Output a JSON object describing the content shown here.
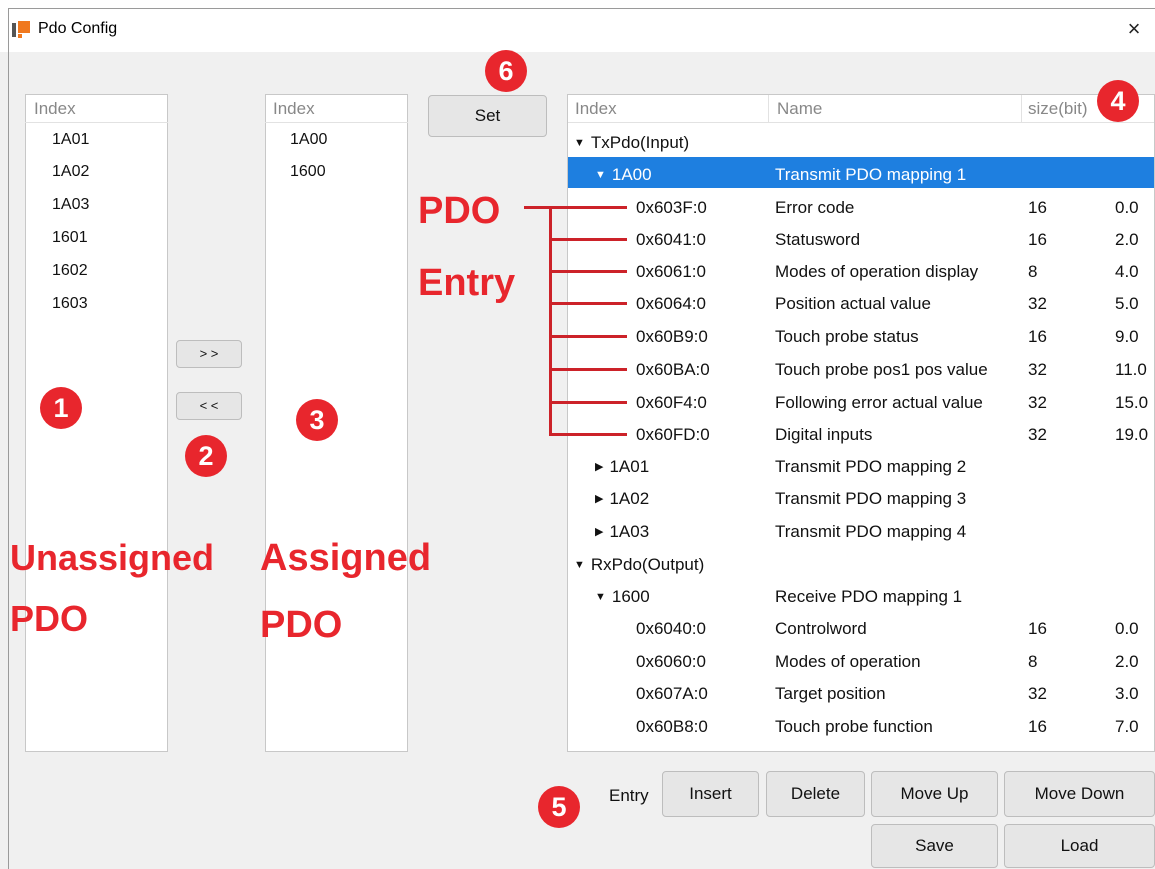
{
  "window": {
    "title": "Pdo Config",
    "close_glyph": "×"
  },
  "left_list": {
    "header": "Index",
    "items": [
      "1A01",
      "1A02",
      "1A03",
      "1601",
      "1602",
      "1603"
    ]
  },
  "middle_list": {
    "header": "Index",
    "items": [
      "1A00",
      "1600"
    ]
  },
  "transfer": {
    "add_label": "> >",
    "remove_label": "< <"
  },
  "set_button": {
    "label": "Set"
  },
  "tree": {
    "columns": [
      "Index",
      "Name",
      "size(bit)"
    ],
    "rows": [
      {
        "index": "TxPdo(Input)",
        "name": "",
        "size": "",
        "offset": "",
        "toggle": "▼"
      },
      {
        "index": "1A00",
        "name": "Transmit PDO mapping 1",
        "size": "",
        "offset": "",
        "toggle": "▼"
      },
      {
        "index": "0x603F:0",
        "name": "Error code",
        "size": "16",
        "offset": "0.0",
        "toggle": ""
      },
      {
        "index": "0x6041:0",
        "name": "Statusword",
        "size": "16",
        "offset": "2.0",
        "toggle": ""
      },
      {
        "index": "0x6061:0",
        "name": "Modes of operation display",
        "size": "8",
        "offset": "4.0",
        "toggle": ""
      },
      {
        "index": "0x6064:0",
        "name": "Position actual value",
        "size": "32",
        "offset": "5.0",
        "toggle": ""
      },
      {
        "index": "0x60B9:0",
        "name": "Touch probe status",
        "size": "16",
        "offset": "9.0",
        "toggle": ""
      },
      {
        "index": "0x60BA:0",
        "name": "Touch probe pos1 pos value",
        "size": "32",
        "offset": "11.0",
        "toggle": ""
      },
      {
        "index": "0x60F4:0",
        "name": "Following error actual value",
        "size": "32",
        "offset": "15.0",
        "toggle": ""
      },
      {
        "index": "0x60FD:0",
        "name": "Digital inputs",
        "size": "32",
        "offset": "19.0",
        "toggle": ""
      },
      {
        "index": "1A01",
        "name": "Transmit PDO mapping 2",
        "size": "",
        "offset": "",
        "toggle": "▶"
      },
      {
        "index": "1A02",
        "name": "Transmit PDO mapping 3",
        "size": "",
        "offset": "",
        "toggle": "▶"
      },
      {
        "index": "1A03",
        "name": "Transmit PDO mapping 4",
        "size": "",
        "offset": "",
        "toggle": "▶"
      },
      {
        "index": "RxPdo(Output)",
        "name": "",
        "size": "",
        "offset": "",
        "toggle": "▼"
      },
      {
        "index": "1600",
        "name": "Receive PDO mapping 1",
        "size": "",
        "offset": "",
        "toggle": "▼"
      },
      {
        "index": "0x6040:0",
        "name": "Controlword",
        "size": "16",
        "offset": "0.0",
        "toggle": ""
      },
      {
        "index": "0x6060:0",
        "name": "Modes of operation",
        "size": "8",
        "offset": "2.0",
        "toggle": ""
      },
      {
        "index": "0x607A:0",
        "name": "Target position",
        "size": "32",
        "offset": "3.0",
        "toggle": ""
      },
      {
        "index": "0x60B8:0",
        "name": "Touch probe function",
        "size": "16",
        "offset": "7.0",
        "toggle": ""
      }
    ]
  },
  "entry_bar": {
    "label": "Entry",
    "insert": "Insert",
    "delete": "Delete",
    "move_up": "Move Up",
    "move_down": "Move Down",
    "save": "Save",
    "load": "Load"
  },
  "annotations": {
    "circles": [
      "1",
      "2",
      "3",
      "4",
      "5",
      "6"
    ],
    "unassigned_line1": "Unassigned",
    "unassigned_line2": "PDO",
    "assigned_line1": "Assigned",
    "assigned_line2": "PDO",
    "pdo_entry_line1": "PDO",
    "pdo_entry_line2": "Entry"
  },
  "colors": {
    "selection": "#1e7fe0",
    "annotation": "#e8262d"
  }
}
